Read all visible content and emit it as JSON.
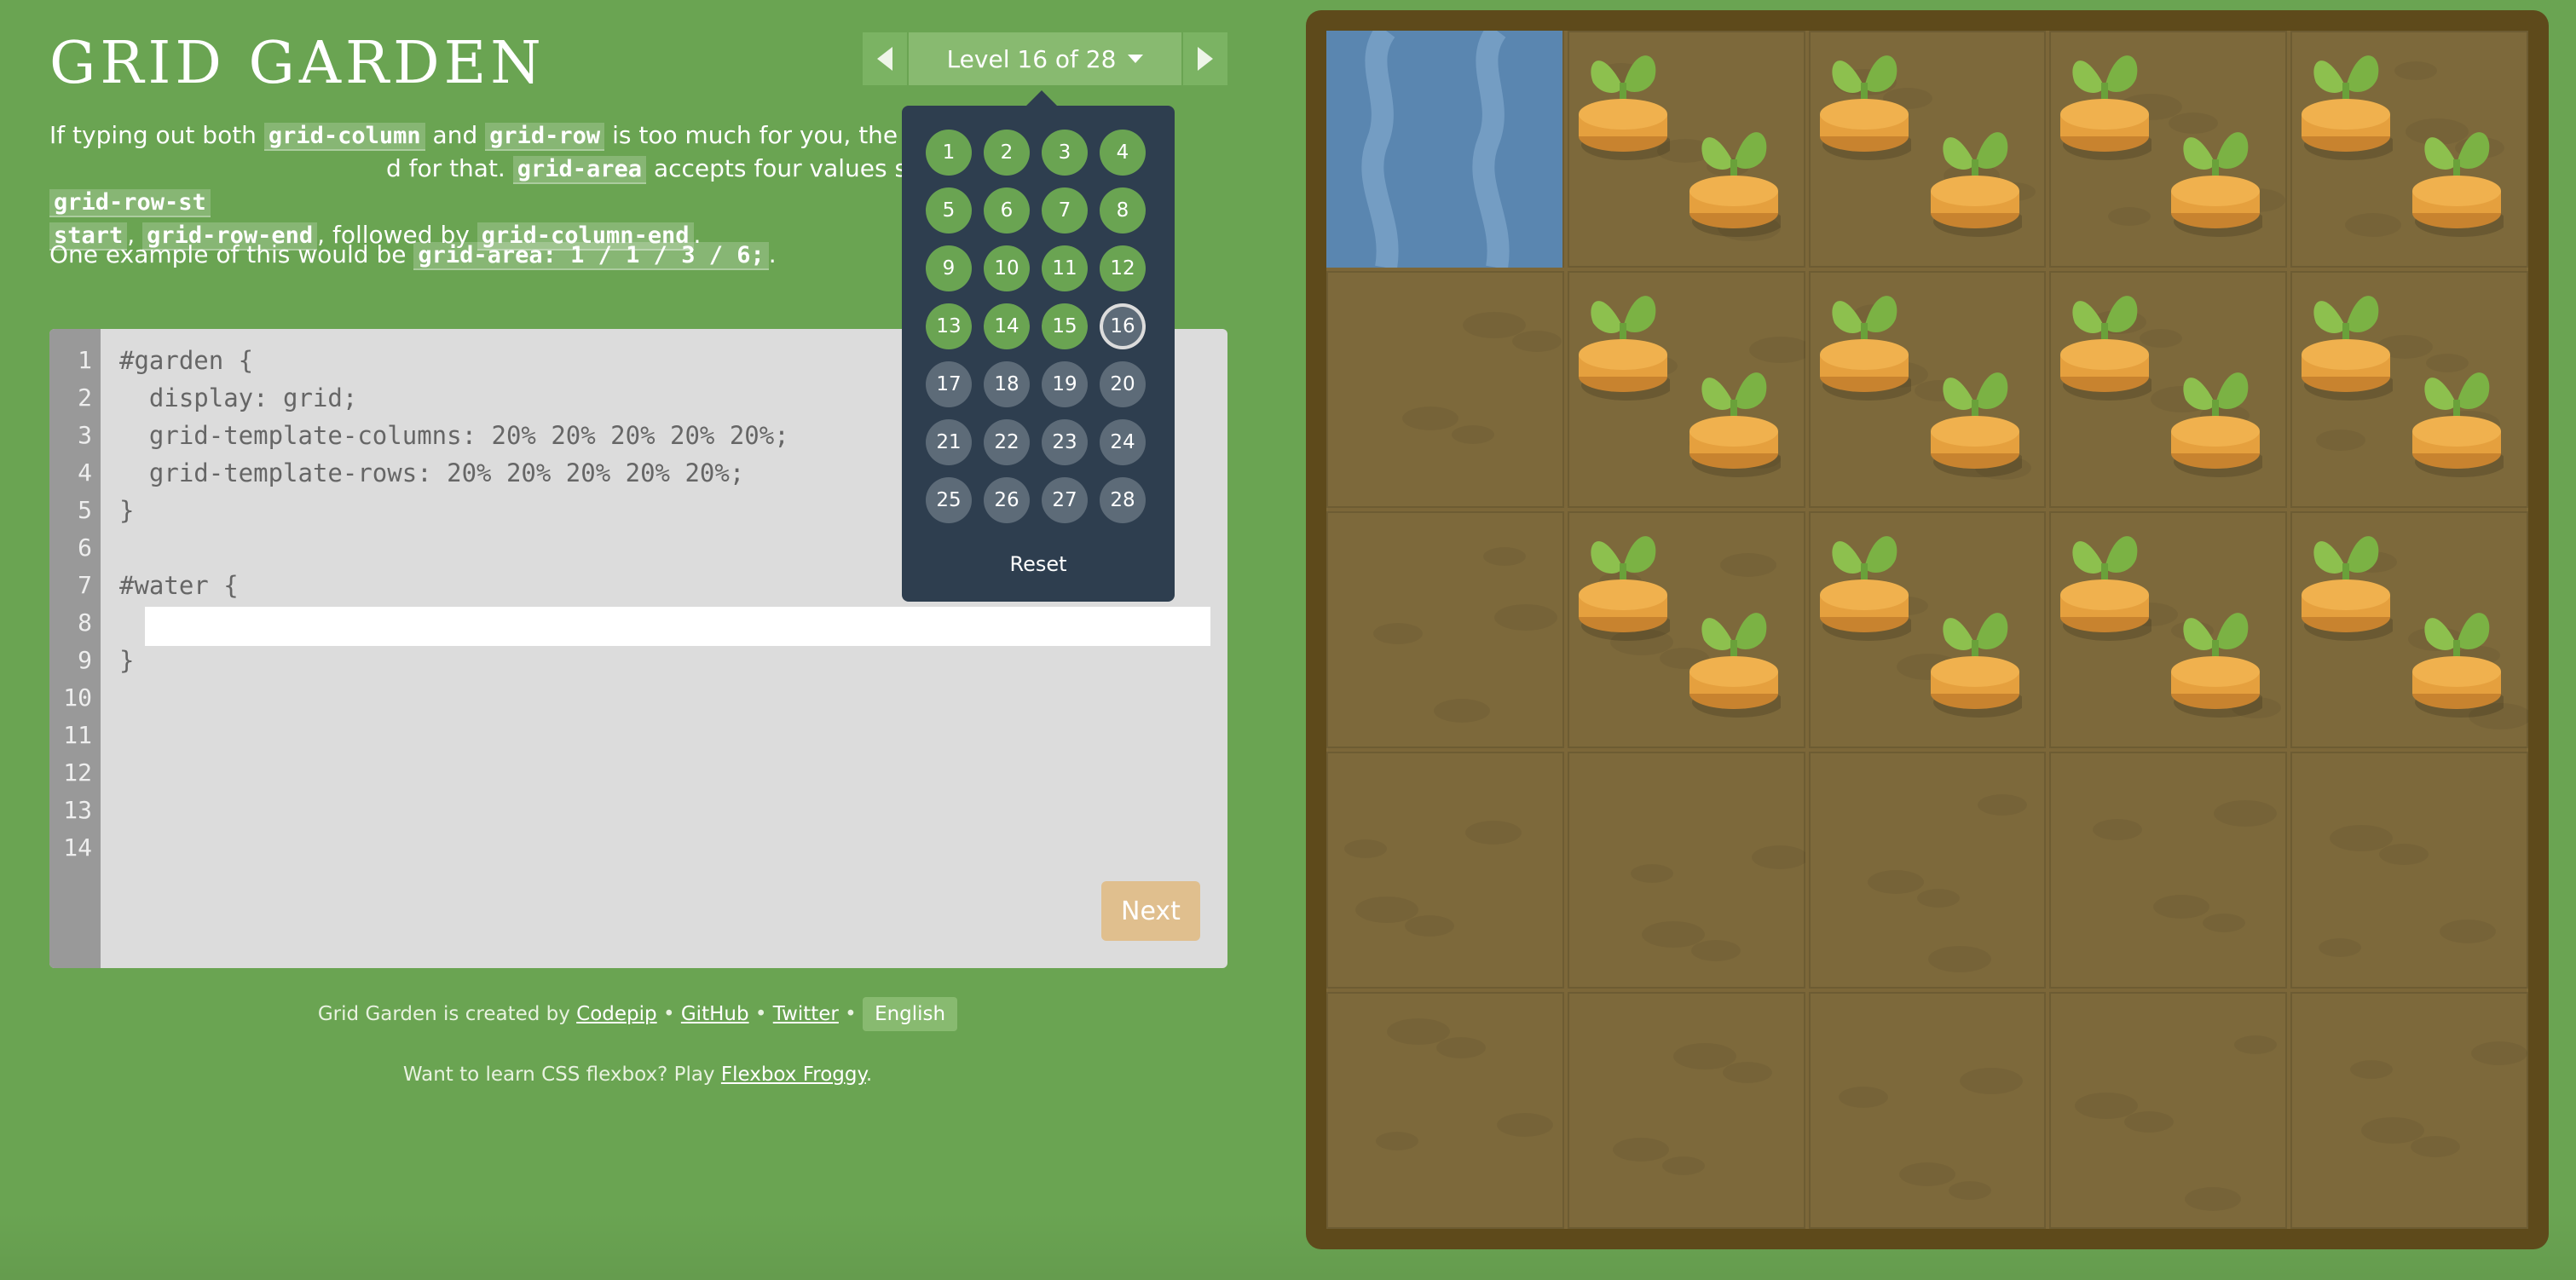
{
  "app": {
    "title": "Grid Garden"
  },
  "level_nav": {
    "current_label": "Level 16 of 28",
    "prev_icon": "triangle-left",
    "next_icon": "triangle-right"
  },
  "instructions": {
    "p1_a": "If typing out both ",
    "p1_code1": "grid-column",
    "p1_b": " and ",
    "p1_code2": "grid-row",
    "p1_c": " is too much for you, the",
    "p1_d": "d for that. ",
    "p1_code3": "grid-area",
    "p1_e": " accepts four values separated by slashes: ",
    "p1_code4": "grid-row-st",
    "p1_code5": "start",
    "p1_f": ", ",
    "p1_code6": "grid-row-end",
    "p1_g": ", followed by ",
    "p1_code7": "grid-column-end",
    "p1_h": ".",
    "p2_a": "One example of this would be ",
    "p2_code": "grid-area: 1 / 1 / 3 / 6;",
    "p2_b": "."
  },
  "editor": {
    "line_numbers": [
      "1",
      "2",
      "3",
      "4",
      "5",
      "6",
      "7",
      "8",
      "9",
      "10",
      "11",
      "12",
      "13",
      "14"
    ],
    "lines": [
      "#garden {",
      "  display: grid;",
      "  grid-template-columns: 20% 20% 20% 20% 20%;",
      "  grid-template-rows: 20% 20% 20% 20% 20%;",
      "}",
      "",
      "#water {",
      "",
      "}"
    ],
    "input_value": "",
    "next_label": "Next"
  },
  "levels": {
    "items": [
      "1",
      "2",
      "3",
      "4",
      "5",
      "6",
      "7",
      "8",
      "9",
      "10",
      "11",
      "12",
      "13",
      "14",
      "15",
      "16",
      "17",
      "18",
      "19",
      "20",
      "21",
      "22",
      "23",
      "24",
      "25",
      "26",
      "27",
      "28"
    ],
    "completed_count": 15,
    "current": "16",
    "reset_label": "Reset"
  },
  "footer": {
    "created_by": "Grid Garden is created by ",
    "codepip": "Codepip",
    "sep": " • ",
    "github": "GitHub",
    "twitter": "Twitter",
    "language": "English",
    "flexbox_text": "Want to learn CSS flexbox? Play ",
    "flexbox_link": "Flexbox Froggy",
    "flexbox_end": "."
  },
  "colors": {
    "background": "#6aa452",
    "soil": "#7d693b",
    "water": "#5a86b0",
    "frame": "#5e4a1b",
    "dropdown": "#2e3e4f",
    "next_button": "#e0bf8e"
  },
  "garden": {
    "columns": 5,
    "rows": 5,
    "water_cell": [
      1,
      1
    ],
    "carrot_rows": [
      1,
      3
    ],
    "carrot_cols": [
      2,
      5
    ]
  }
}
